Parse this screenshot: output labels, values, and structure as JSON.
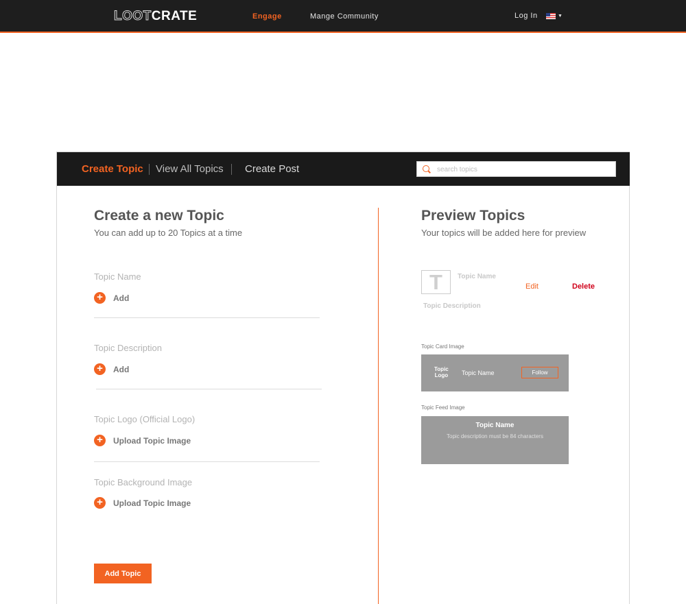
{
  "nav": {
    "logo_part1": "LOOT",
    "logo_part2": "CRATE",
    "engage": "Engage",
    "community": "Mange Community",
    "login": "Log In"
  },
  "tabs": {
    "create": "Create Topic",
    "viewall": "View All Topics",
    "post": "Create Post"
  },
  "search": {
    "placeholder": "search topics"
  },
  "form": {
    "title": "Create a new Topic",
    "subtitle": "You can add up to 20 Topics at a time",
    "fields": [
      {
        "label": "Topic Name",
        "action": "Add"
      },
      {
        "label": "Topic Description",
        "action": "Add"
      },
      {
        "label": "Topic Logo (Official Logo)",
        "action": "Upload Topic Image"
      },
      {
        "label": "Topic Background Image",
        "action": "Upload Topic Image"
      }
    ],
    "submit": "Add Topic"
  },
  "preview": {
    "title": "Preview Topics",
    "subtitle": "Your topics will be added here for preview",
    "logo_letter": "T",
    "topic_name": "Topic Name",
    "topic_description": "Topic Description",
    "edit": "Edit",
    "delete": "Delete",
    "card_label": "Topic Card Image",
    "card_logo": "Topic\nLogo",
    "card_name": "Topic Name",
    "card_follow": "Follow",
    "feed_label": "Topic Feed Image",
    "feed_name": "Topic Name",
    "feed_desc": "Topic description must be 84 characters"
  },
  "colors": {
    "accent": "#f26322",
    "dark": "#1e1e1e",
    "delete": "#d0021b",
    "card_bg": "#9b9b9b"
  }
}
